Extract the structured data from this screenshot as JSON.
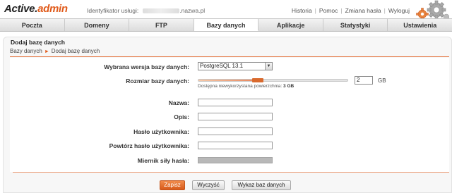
{
  "header": {
    "logo_main": "Active.",
    "logo_accent": "admin",
    "identifier_label": "Identyfikator usługi:",
    "identifier_domain": ".nazwa.pl",
    "links": [
      "Historia",
      "Pomoc",
      "Zmiana hasła",
      "Wyloguj"
    ],
    "gears_icon": "gears-icon"
  },
  "nav": {
    "tabs": [
      {
        "label": "Poczta"
      },
      {
        "label": "Domeny"
      },
      {
        "label": "FTP"
      },
      {
        "label": "Bazy danych",
        "active": true
      },
      {
        "label": "Aplikacje"
      },
      {
        "label": "Statystyki"
      },
      {
        "label": "Ustawienia"
      }
    ]
  },
  "panel": {
    "title": "Dodaj bazę danych",
    "breadcrumb": [
      "Bazy danych",
      "Dodaj bazę danych"
    ]
  },
  "form": {
    "version_label": "Wybrana wersja bazy danych:",
    "version_value": "PostgreSQL 13.1",
    "size_label": "Rozmiar bazy danych:",
    "size_value": "2",
    "size_unit": "GB",
    "size_note_prefix": "Dostępna niewykorzystana powierzchnia:",
    "size_note_value": "3 GB",
    "size_fraction": 0.4,
    "name_label": "Nazwa:",
    "name_value": "",
    "desc_label": "Opis:",
    "desc_value": "",
    "user_pass_label": "Hasło użytkownika:",
    "user_pass_value": "",
    "user_pass_repeat_label": "Powtórz hasło użytkownika:",
    "user_pass_repeat_value": "",
    "strength_label": "Miernik siły hasła:"
  },
  "buttons": {
    "save": "Zapisz",
    "clear": "Wyczyść",
    "list": "Wykaz baz danych"
  },
  "colors": {
    "accent": "#e05a1a"
  }
}
